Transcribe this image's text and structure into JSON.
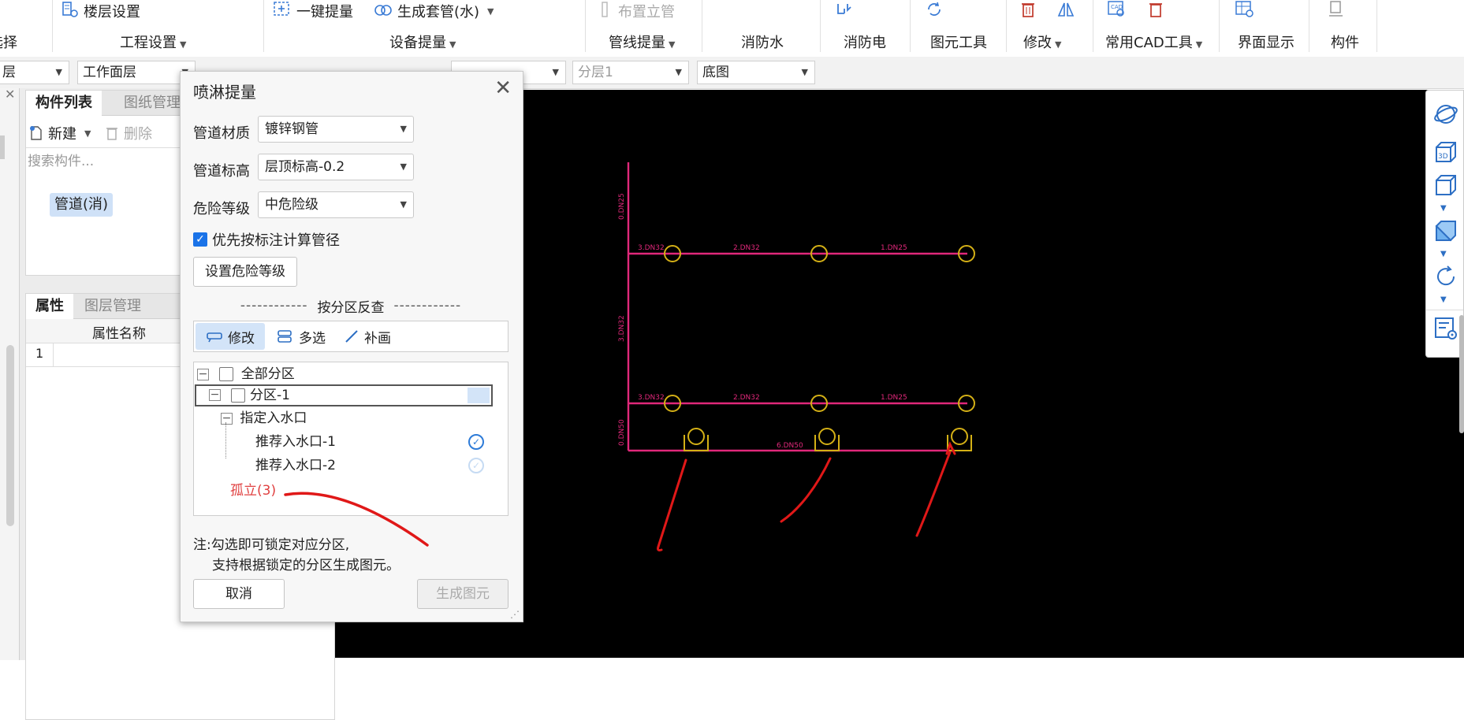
{
  "ribbon": {
    "top_buttons": {
      "floor_settings": "楼层设置",
      "one_click_extract": "一键提量",
      "generate_sleeve": "生成套管(水)",
      "place_riser": "布置立管"
    },
    "groups": {
      "select": "选择",
      "project_settings": "工程设置",
      "equipment_extract": "设备提量",
      "pipeline_extract": "管线提量",
      "fire_water": "消防水",
      "fire_electric": "消防电",
      "element_tools": "图元工具",
      "modify": "修改",
      "common_cad": "常用CAD工具",
      "interface_display": "界面显示",
      "component": "构件"
    }
  },
  "toolbar": {
    "floor_combo": "层",
    "work_layer_combo": "工作面层",
    "sublayer_combo": "分层1",
    "base_map_combo": "底图"
  },
  "left_panel": {
    "tabs_top": [
      "构件列表",
      "图纸管理"
    ],
    "new_label": "新建",
    "delete_label": "删除",
    "search_placeholder": "搜索构件...",
    "component_item": "管道(消)",
    "tabs_bottom": [
      "属性",
      "图层管理"
    ],
    "prop_header": "属性名称",
    "prop_row_index": "1"
  },
  "dialog": {
    "title": "喷淋提量",
    "pipe_material_label": "管道材质",
    "pipe_material_value": "镀锌钢管",
    "pipe_elevation_label": "管道标高",
    "pipe_elevation_value": "层顶标高-0.2",
    "hazard_label": "危险等级",
    "hazard_value": "中危险级",
    "priority_check_label": "优先按标注计算管径",
    "priority_checked": true,
    "set_hazard_button": "设置危险等级",
    "section_title": "按分区反查",
    "mode_buttons": [
      "修改",
      "多选",
      "补画"
    ],
    "tree": {
      "all_zones": "全部分区",
      "zone1": "分区-1",
      "inlet": "指定入水口",
      "inlet_rec1": "推荐入水口-1",
      "inlet_rec2": "推荐入水口-2",
      "isolated": "孤立(3)"
    },
    "note_line1": "注:勾选即可锁定对应分区,",
    "note_line2": "支持根据锁定的分区生成图元。",
    "cancel_button": "取消",
    "generate_button": "生成图元"
  },
  "cad": {
    "pipe_labels": [
      "3.DN32",
      "2.DN32",
      "1.DN25",
      "3.DN32",
      "2.DN32",
      "1.DN25",
      "0.DN50",
      "3.DN32",
      "6.DN50",
      "0.DN25"
    ]
  },
  "colors": {
    "canvas": "#000000",
    "pipe": "#e0287a",
    "sprinkler": "#d4b016",
    "annotation": "#e01818",
    "accent": "#1a73e8"
  }
}
